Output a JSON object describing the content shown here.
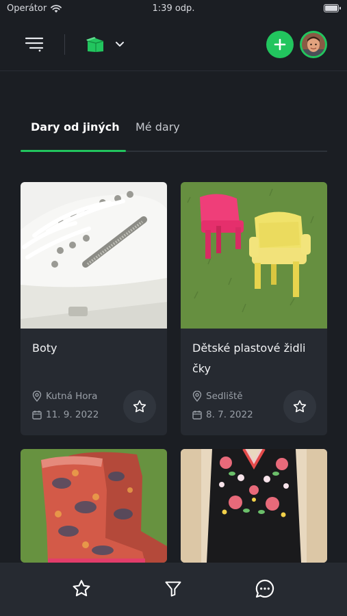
{
  "status_bar": {
    "carrier": "Operátor",
    "time": "1:39 odp."
  },
  "header": {
    "logo_icon": "green-box-logo-icon",
    "menu_icon": "menu-icon",
    "add_icon": "plus-icon",
    "avatar_icon": "user-avatar"
  },
  "tabs": [
    {
      "label": "Dary od jiných",
      "active": true
    },
    {
      "label": "Mé dary",
      "active": false
    }
  ],
  "items": [
    {
      "title": "Boty",
      "location": "Kutná Hora",
      "date": "11. 9. 2022"
    },
    {
      "title": "Dětské plastové židli čky",
      "location": "Sedliště",
      "date": "8. 7. 2022"
    },
    {
      "title": "",
      "location": "",
      "date": ""
    },
    {
      "title": "",
      "location": "",
      "date": ""
    }
  ],
  "bottom_nav": [
    {
      "icon": "star-icon"
    },
    {
      "icon": "filter-icon"
    },
    {
      "icon": "chat-icon"
    }
  ],
  "colors": {
    "accent": "#22c55e",
    "background": "#1b1e23",
    "card": "#262a31"
  }
}
